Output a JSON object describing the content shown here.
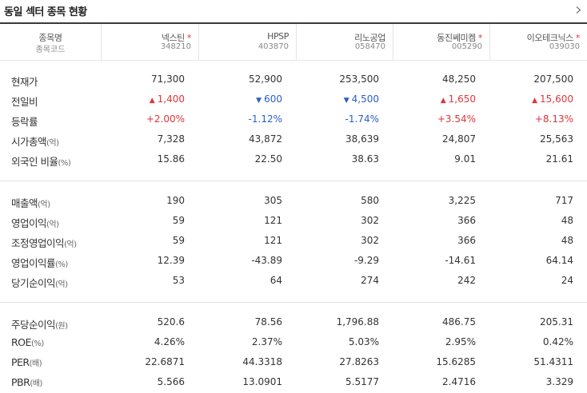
{
  "title": "동일 섹터 종목 현황",
  "header": {
    "name_label": "종목명",
    "code_label": "종목코드",
    "stocks": [
      {
        "name": "넥스틴",
        "code": "348210",
        "star": "*"
      },
      {
        "name": "HPSP",
        "code": "403870",
        "star": ""
      },
      {
        "name": "리노공업",
        "code": "058470",
        "star": ""
      },
      {
        "name": "동진쎄미켐",
        "code": "005290",
        "star": "*"
      },
      {
        "name": "이오테크닉스",
        "code": "039030",
        "star": "*"
      }
    ]
  },
  "rows": {
    "price": {
      "label": "현재가",
      "unit": "",
      "values": [
        "71,300",
        "52,900",
        "253,500",
        "48,250",
        "207,500"
      ]
    },
    "change": {
      "label": "전일비",
      "unit": "",
      "values": [
        "1,400",
        "600",
        "4,500",
        "1,650",
        "15,600"
      ],
      "directions": [
        "up",
        "down",
        "down",
        "up",
        "up"
      ]
    },
    "rate": {
      "label": "등락률",
      "unit": "",
      "values": [
        "+2.00%",
        "-1.12%",
        "-1.74%",
        "+3.54%",
        "+8.13%"
      ],
      "directions": [
        "up",
        "down",
        "down",
        "up",
        "up"
      ]
    },
    "mcap": {
      "label": "시가총액",
      "unit": "(억)",
      "values": [
        "7,328",
        "43,872",
        "38,639",
        "24,807",
        "25,563"
      ]
    },
    "foreign": {
      "label": "외국인 비율",
      "unit": "(%)",
      "values": [
        "15.86",
        "22.50",
        "38.63",
        "9.01",
        "21.61"
      ]
    },
    "sales": {
      "label": "매출액",
      "unit": "(억)",
      "values": [
        "190",
        "305",
        "580",
        "3,225",
        "717"
      ]
    },
    "op": {
      "label": "영업이익",
      "unit": "(억)",
      "values": [
        "59",
        "121",
        "302",
        "366",
        "48"
      ]
    },
    "adjop": {
      "label": "조정영업이익",
      "unit": "(억)",
      "values": [
        "59",
        "121",
        "302",
        "366",
        "48"
      ]
    },
    "opm": {
      "label": "영업이익률",
      "unit": "(%)",
      "values": [
        "12.39",
        "-43.89",
        "-9.29",
        "-14.61",
        "64.14"
      ]
    },
    "net": {
      "label": "당기순이익",
      "unit": "(억)",
      "values": [
        "53",
        "64",
        "274",
        "242",
        "24"
      ]
    },
    "eps": {
      "label": "주당순이익",
      "unit": "(원)",
      "values": [
        "520.6",
        "78.56",
        "1,796.88",
        "486.75",
        "205.31"
      ]
    },
    "roe": {
      "label": "ROE",
      "unit": "(%)",
      "values": [
        "4.26%",
        "2.37%",
        "5.03%",
        "2.95%",
        "0.42%"
      ]
    },
    "per": {
      "label": "PER",
      "unit": "(배)",
      "values": [
        "22.6871",
        "44.3318",
        "27.8263",
        "15.6285",
        "51.4311"
      ]
    },
    "pbr": {
      "label": "PBR",
      "unit": "(배)",
      "values": [
        "5.566",
        "13.0901",
        "5.5177",
        "2.4716",
        "3.329"
      ]
    }
  },
  "colors": {
    "up": "#e0353a",
    "down": "#2a5ec8"
  },
  "icons": {
    "more": "chevron-right-icon",
    "up": "triangle-up-icon",
    "down": "triangle-down-icon"
  }
}
